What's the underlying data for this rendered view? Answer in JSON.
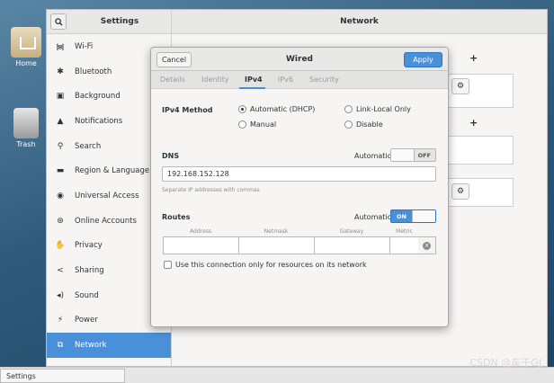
{
  "desktop": {
    "icons": [
      {
        "label": "Home"
      },
      {
        "label": "Trash"
      }
    ]
  },
  "settings": {
    "sidebar_title": "Settings",
    "content_title": "Network",
    "nav_items": [
      {
        "label": "Wi-Fi",
        "icon": "wifi-icon"
      },
      {
        "label": "Bluetooth",
        "icon": "bluetooth-icon"
      },
      {
        "label": "Background",
        "icon": "background-icon"
      },
      {
        "label": "Notifications",
        "icon": "bell-icon"
      },
      {
        "label": "Search",
        "icon": "search-icon"
      },
      {
        "label": "Region & Language",
        "icon": "keyboard-icon"
      },
      {
        "label": "Universal Access",
        "icon": "accessibility-icon"
      },
      {
        "label": "Online Accounts",
        "icon": "online-accounts-icon"
      },
      {
        "label": "Privacy",
        "icon": "hand-icon"
      },
      {
        "label": "Sharing",
        "icon": "share-icon"
      },
      {
        "label": "Sound",
        "icon": "speaker-icon"
      },
      {
        "label": "Power",
        "icon": "power-icon"
      },
      {
        "label": "Network",
        "icon": "network-icon",
        "active": true
      }
    ],
    "plus_label": "+",
    "gear_glyph": "⚙"
  },
  "dialog": {
    "cancel_label": "Cancel",
    "title": "Wired",
    "apply_label": "Apply",
    "tabs": [
      "Details",
      "Identity",
      "IPv4",
      "IPv6",
      "Security"
    ],
    "active_tab": "IPv4",
    "ipv4_method_label": "IPv4 Method",
    "methods": {
      "automatic_dhcp": "Automatic (DHCP)",
      "link_local": "Link-Local Only",
      "manual": "Manual",
      "disable": "Disable"
    },
    "selected_method": "Automatic (DHCP)",
    "dns": {
      "label": "DNS",
      "automatic_label": "Automatic",
      "automatic_state": "OFF",
      "value": "192.168.152.128",
      "hint": "Separate IP addresses with commas"
    },
    "routes": {
      "label": "Routes",
      "automatic_label": "Automatic",
      "automatic_state": "ON",
      "columns": [
        "Address",
        "Netmask",
        "Gateway",
        "Metric"
      ],
      "delete_glyph": "×"
    },
    "checkbox_label": "Use this connection only for resources on its network"
  },
  "taskbar": {
    "item_label": "Settings"
  },
  "watermark": "CSDN @车干GJ"
}
